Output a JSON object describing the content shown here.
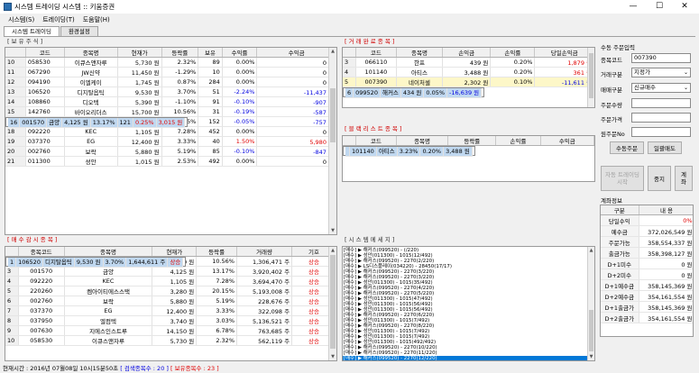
{
  "window": {
    "title": "시스템 트레이딩 시스템 :: 키움증권",
    "min": "—",
    "max": "☐",
    "close": "✕"
  },
  "menu": [
    "시스템(S)",
    "트레이딩(T)",
    "도움말(H)"
  ],
  "tabs": [
    "시스템 트레이딩",
    "환경설정"
  ],
  "holdings": {
    "title": "[ 보 유 주 식 ]",
    "headers": [
      "",
      "코드",
      "종목명",
      "현재가",
      "등락률",
      "보유",
      "수익률",
      "수익금"
    ],
    "rows": [
      [
        "10",
        "058530",
        "이큐스앤자루",
        "5,730 원",
        "2.32%",
        "89",
        "0.00%",
        "0 원"
      ],
      [
        "11",
        "067290",
        "JW신약",
        "11,450 원",
        "-1.29%",
        "10",
        "0.00%",
        "0 원"
      ],
      [
        "12",
        "094190",
        "이엘케이",
        "1,745 원",
        "0.87%",
        "284",
        "0.00%",
        "0 원"
      ],
      [
        "13",
        "106520",
        "디지탈옵틱",
        "9,530 원",
        "3.70%",
        "51",
        "-2.24%",
        "-11,437 원"
      ],
      [
        "14",
        "108860",
        "디오텍",
        "5,390 원",
        "-1.10%",
        "91",
        "-0.10%",
        "-907 원"
      ],
      [
        "15",
        "142760",
        "바이오리더스",
        "15,700 원",
        "10.56%",
        "31",
        "-0.19%",
        "-587 원"
      ],
      [
        "16",
        "001570",
        "금양",
        "4,125 원",
        "13.17%",
        "121",
        "0.25%",
        "3,015 원"
      ],
      [
        "17",
        "220260",
        "켐아이티에...",
        "3,280 원",
        "20.15%",
        "152",
        "-0.05%",
        "-757 원"
      ],
      [
        "18",
        "092220",
        "KEC",
        "1,105 원",
        "7.28%",
        "452",
        "0.00%",
        "0 원"
      ],
      [
        "19",
        "037370",
        "EG",
        "12,400 원",
        "3.33%",
        "40",
        "1.50%",
        "5,980 원"
      ],
      [
        "20",
        "002760",
        "보락",
        "5,880 원",
        "5.19%",
        "85",
        "-0.10%",
        "-847 원"
      ],
      [
        "21",
        "011300",
        "성안",
        "1,015 원",
        "2.53%",
        "492",
        "0.00%",
        "0 원"
      ]
    ]
  },
  "completed": {
    "title": "[ 거 래 완 료 종 목 ]",
    "headers": [
      "",
      "코드",
      "종목명",
      "손익금",
      "손익률",
      "당일손익금"
    ],
    "rows": [
      [
        "3",
        "066110",
        "한프",
        "439 원",
        "0.20%",
        "1,879 원"
      ],
      [
        "4",
        "101140",
        "아티스",
        "3,488 원",
        "0.20%",
        "361 원"
      ],
      [
        "5",
        "007390",
        "네이처셀",
        "2,302 원",
        "0.10%",
        "-11,611 원"
      ],
      [
        "6",
        "099520",
        "해커스",
        "434 원",
        "0.05%",
        "-16,639 원"
      ]
    ]
  },
  "blacklist": {
    "title": "[ 블 랙 리 스 트 종 목 ]",
    "headers": [
      "",
      "코드",
      "종목명",
      "등락률",
      "손익률",
      "수익금"
    ],
    "rows": [
      [
        "",
        "101140",
        "아티스",
        "3.23%",
        "0.20%",
        "3,488 원"
      ]
    ]
  },
  "watch": {
    "title": "[ 매 수 감 시 종 목 ]",
    "headers": [
      "",
      "종목코드",
      "종목명",
      "현재가",
      "등락률",
      "거래량",
      "기호"
    ],
    "rows": [
      [
        "1",
        "106520",
        "디지탈옵틱",
        "9,530 원",
        "3.70%",
        "1,644,611 주",
        "상승"
      ],
      [
        "2",
        "142760",
        "바이오리더스",
        "15,700 원",
        "10.56%",
        "1,306,471 주",
        "상승"
      ],
      [
        "3",
        "001570",
        "금양",
        "4,125 원",
        "13.17%",
        "3,920,402 주",
        "상승"
      ],
      [
        "4",
        "092220",
        "KEC",
        "1,105 원",
        "7.28%",
        "3,694,470 주",
        "상승"
      ],
      [
        "5",
        "220260",
        "켐아이티에스스택",
        "3,280 원",
        "20.15%",
        "5,193,008 주",
        "상승"
      ],
      [
        "6",
        "002760",
        "보락",
        "5,880 원",
        "5.19%",
        "228,676 주",
        "상승"
      ],
      [
        "7",
        "037370",
        "EG",
        "12,400 원",
        "3.33%",
        "322,098 주",
        "상승"
      ],
      [
        "8",
        "037950",
        "엘컴텍",
        "3,740 원",
        "3.03%",
        "5,136,521 주",
        "상승"
      ],
      [
        "9",
        "007630",
        "지에스인스트루",
        "14,150 원",
        "6.78%",
        "763,685 주",
        "상승"
      ],
      [
        "10",
        "058530",
        "이큐스앤자루",
        "5,730 원",
        "2.32%",
        "562,119 주",
        "상승"
      ]
    ]
  },
  "syslog": {
    "title": "[ 시 스 템 메 세 지 ]",
    "lines": [
      "[매수] ▶ 해커스(099520) - (/220)",
      "[매수] ▶ 성안(011300) - 1015(12/492)",
      "[매수] ▶ 해커스(099520) - 2270(2/220)",
      "[매수] ▶ LS디스플레이(034220) - 28450(17/17)",
      "[매수] ▶ 해커스(099520) - 2270(3/220)",
      "[매수] ▶ 해커스(099520) - 2270(3/220)",
      "[매수] ▶ 성안(011300) - 1015(35/492)",
      "[매수] ▶ 해커스(099520) - 2270(4/220)",
      "[매수] ▶ 해커스(099520) - 2270(5/220)",
      "[매수] ▶ 성안(011300) - 1015(47/492)",
      "[매수] ▶ 성안(011300) - 1015(56/492)",
      "[매수] ▶ 성안(011300) - 1015(56/492)",
      "[매수] ▶ 해커스(099520) - 2270(6/220)",
      "[매수] ▶ 성안(011300) - 1015(7/492)",
      "[매수] ▶ 해커스(099520) - 2270(8/220)",
      "[매수] ▶ 성안(011300) - 1015(7/492)",
      "[매수] ▶ 성안(011300) - 1015(7/492)",
      "[매수] ▶ 성안(011300) - 1015(492/492)",
      "[매수] ▶ 해커스(099520) - 2270(10/220)",
      "[매수] ▶ 해커스(099520) - 2270(11/220)",
      "[매수] ▶ 해커스(099520) - 2270(12/220)"
    ]
  },
  "order": {
    "title": "수동 주문입력",
    "code_label": "종목코드",
    "code_value": "007390",
    "type_label": "거래구분",
    "type_value": "지정가",
    "side_label": "매매구분",
    "side_value": "신규매수",
    "qty_label": "주문수량",
    "price_label": "주문가격",
    "orig_label": "원주문No",
    "order_btn": "수동주문",
    "cancel_btn": "일괄매도"
  },
  "controls": {
    "start": "자동 트레이딩 시작",
    "stop": "중지",
    "calc": "계좌"
  },
  "account": {
    "title": "계좌정보",
    "headers": [
      "구분",
      "내  용"
    ],
    "rows": [
      [
        "당일수익",
        "0%"
      ],
      [
        "예수금",
        "372,026,549 원"
      ],
      [
        "주문가능",
        "358,554,337 원"
      ],
      [
        "출금가능",
        "358,398,127 원"
      ],
      [
        "D+1미수",
        "0 원"
      ],
      [
        "D+2미수",
        "0 원"
      ],
      [
        "D+1예수금",
        "358,145,369 원"
      ],
      [
        "D+2예수금",
        "354,161,554 원"
      ],
      [
        "D+1출금가",
        "358,145,369 원"
      ],
      [
        "D+2출금가",
        "354,161,554 원"
      ]
    ]
  },
  "status": {
    "time": "현재시간 : 2016년 07월08일 10시15분50초",
    "search": "[ 검색종목수 : 20 ]",
    "hold": "[ 보유종목수 : 23 ]"
  },
  "colors": {
    "up": "#e00000",
    "down": "#0000e0",
    "selected": "#c0d8f0",
    "highlight": "#0078d7"
  }
}
